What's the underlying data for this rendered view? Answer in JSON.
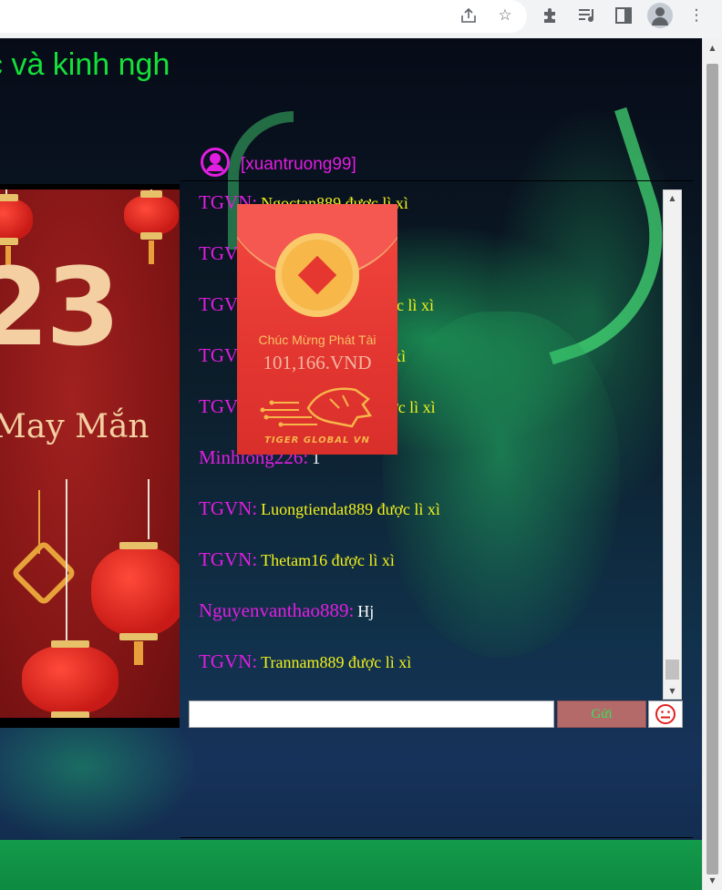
{
  "heading": "c và kinh ngh",
  "chat": {
    "username": "[xuantruong99]",
    "messages": [
      {
        "sender": "TGVN:",
        "text": "Ngoctan889 được lì xì"
      },
      {
        "sender": "TGV",
        "text": ""
      },
      {
        "sender": "TGV",
        "text": "3 được lì xì"
      },
      {
        "sender": "TGV",
        "text": "xì"
      },
      {
        "sender": "TGV",
        "text": "ợc lì xì"
      },
      {
        "sender": "Minhlong226:",
        "text": "1"
      },
      {
        "sender": "TGVN:",
        "text": "Luongtiendat889 được lì xì"
      },
      {
        "sender": "TGVN:",
        "text": "Thetam16 được lì xì"
      },
      {
        "sender": "Nguyenvanthao889:",
        "text": "Hj"
      },
      {
        "sender": "TGVN:",
        "text": "Trannam889 được lì xì"
      }
    ],
    "input_value": "",
    "send_label": "Gửi"
  },
  "banner": {
    "year": "23",
    "caption": "May Mắn"
  },
  "envelope": {
    "wish": "Chúc Mừng Phát Tài",
    "amount": "101,166.VND",
    "brand": "TIGER GLOBAL VN"
  },
  "toolbar_icons": [
    "share-icon",
    "bookmark-star-icon",
    "extensions-icon",
    "media-queue-icon",
    "side-panel-icon",
    "profile-icon",
    "more-menu-icon"
  ],
  "colors": {
    "heading": "#15e03a",
    "sender": "#e21de2",
    "message": "#f2f21a",
    "envelope": "#e33631",
    "send_button": "#b56a6a"
  }
}
